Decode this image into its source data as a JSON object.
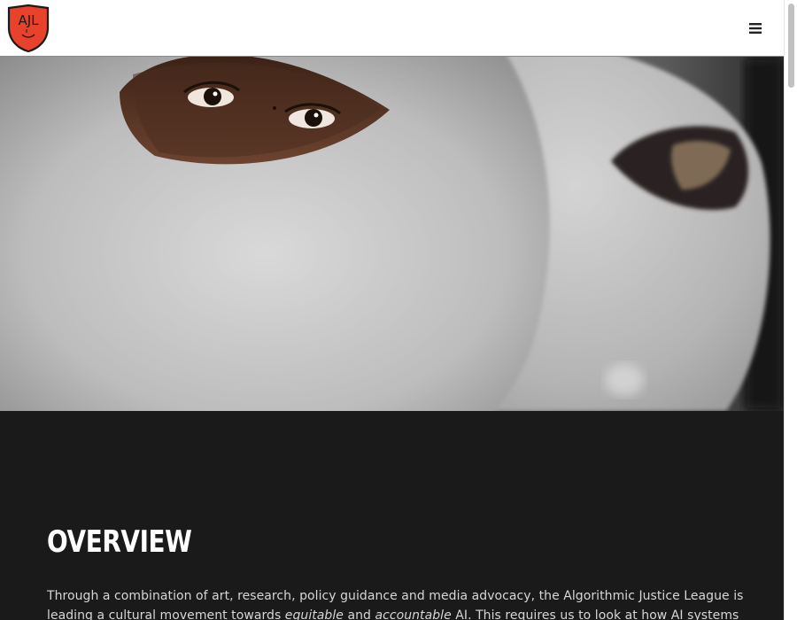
{
  "header": {
    "logo_text": "AJL",
    "menu_icon": "hamburger-menu-icon"
  },
  "hero": {
    "image": "person-behind-white-mask"
  },
  "overview": {
    "title": "OVERVIEW",
    "text_before": "Through a combination of art, research, policy guidance and media advocacy, the Algorithmic Justice League is leading a cultural movement towards ",
    "em1": "equitable",
    "text_mid": " and ",
    "em2": "accountable",
    "text_after": " AI. This requires us to look at how AI systems are"
  },
  "colors": {
    "header_bg": "#ffffff",
    "content_bg": "#1a1a1a",
    "logo_red": "#e8412c",
    "title_color": "#ffffff",
    "body_color": "#d6d6d6"
  }
}
